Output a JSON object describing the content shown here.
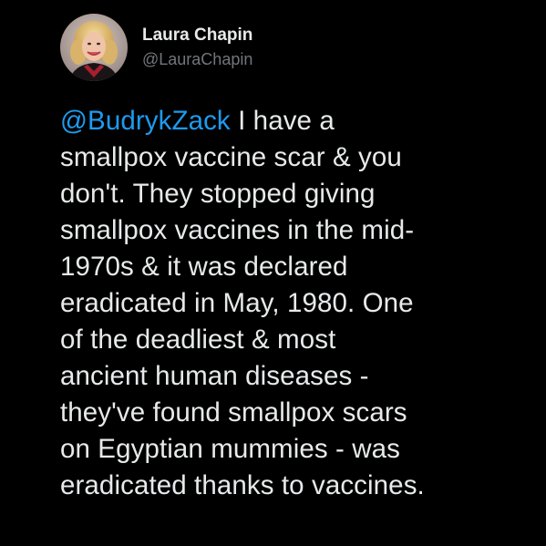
{
  "theme": {
    "background": "#000000",
    "text_color": "#e7e9ea",
    "secondary_text": "#71767b",
    "link_color": "#1d9bf0"
  },
  "author": {
    "display_name": "Laura Chapin",
    "handle": "@LauraChapin",
    "avatar_icon": "profile-photo"
  },
  "tweet": {
    "mention": "@BudrykZack",
    "lines": [
      " I have a",
      "smallpox vaccine scar & you",
      "don't. They stopped giving",
      "smallpox vaccines in the mid-",
      "1970s & it was declared",
      "eradicated in May, 1980. One",
      "of the deadliest & most",
      "ancient human diseases -",
      "they've found smallpox scars",
      "on Egyptian mummies - was",
      "eradicated thanks to vaccines."
    ]
  }
}
